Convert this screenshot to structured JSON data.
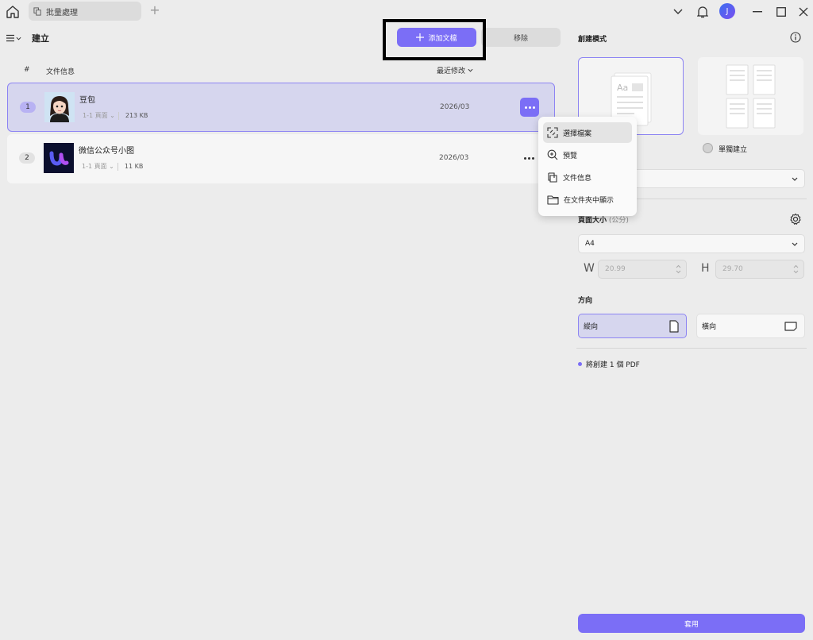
{
  "titlebar": {
    "tab_label": "批量處理",
    "avatar_initial": "J"
  },
  "left": {
    "title": "建立",
    "add_button": "添加文檔",
    "remove_button": "移除",
    "columns": {
      "number": "#",
      "info": "文件信息",
      "modified": "最近修改"
    },
    "rows": [
      {
        "num": "1",
        "name": "豆包",
        "pages": "1-1 頁面",
        "size": "213 KB",
        "date": "2026/03"
      },
      {
        "num": "2",
        "name": "微信公众号小图",
        "pages": "1-1 頁面",
        "size": "11 KB",
        "date": "2026/03"
      }
    ]
  },
  "context_menu": {
    "items": [
      {
        "label": "選擇檔案",
        "icon": "swap-file-icon"
      },
      {
        "label": "預覽",
        "icon": "zoom-in-icon"
      },
      {
        "label": "文件信息",
        "icon": "file-info-icon"
      },
      {
        "label": "在文件夾中顯示",
        "icon": "folder-icon"
      }
    ]
  },
  "right": {
    "mode_title": "創建模式",
    "mode_single_label": "單獨建立",
    "page_size_title": "頁面大小",
    "page_size_unit": "(公分)",
    "page_size_value": "A4",
    "width_label": "W",
    "width_value": "20.99",
    "height_label": "H",
    "height_value": "29.70",
    "orientation_title": "方向",
    "portrait": "縱向",
    "landscape": "橫向",
    "summary": "將創建 1 個 PDF",
    "apply": "套用"
  },
  "colors": {
    "accent": "#7b6ef6",
    "selected_bg": "#d6d6ee"
  }
}
